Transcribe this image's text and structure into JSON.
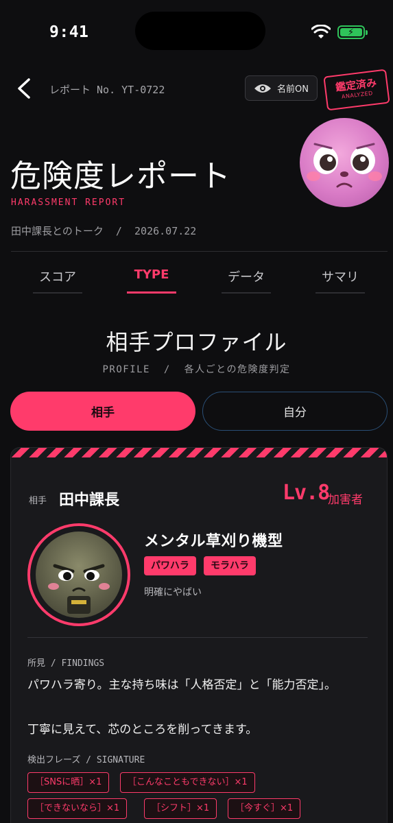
{
  "status_bar": {
    "time": "9:41"
  },
  "header": {
    "report_no": "レポート No. YT-0722",
    "name_toggle_label": "名前ON",
    "stamp_main": "鑑定済み",
    "stamp_sub": "ANALYZED"
  },
  "title": {
    "main": "危険度レポート",
    "subtitle": "HARASSMENT REPORT",
    "meta": "田中課長とのトーク  /  2026.07.22"
  },
  "tabs": [
    {
      "label": "スコア",
      "active": false
    },
    {
      "label": "TYPE",
      "active": true
    },
    {
      "label": "データ",
      "active": false
    },
    {
      "label": "サマリ",
      "active": false
    }
  ],
  "section": {
    "title": "相手プロファイル",
    "subtitle": "PROFILE  /  各人ごとの危険度判定"
  },
  "segments": {
    "left": "相手",
    "right": "自分"
  },
  "card": {
    "label": "相手",
    "name": "田中課長",
    "level": "Lv.8",
    "role": "加害者",
    "type_name": "メンタル草刈り機型",
    "tags": [
      "パワハラ",
      "モラハラ"
    ],
    "verdict": "明確にやばい",
    "findings_label": "所見 / FINDINGS",
    "findings_line1": "パワハラ寄り。主な持ち味は「人格否定」と「能力否定」。",
    "findings_line2": "丁寧に見えて、芯のところを削ってきます。",
    "signature_label": "検出フレーズ / SIGNATURE",
    "phrases": [
      "［SNSに晒］×1",
      "［こんなこともできない］×1",
      "［できないなら］×1",
      "［シフト］×1",
      "［今すぐ］×1"
    ]
  },
  "colors": {
    "accent": "#ff3b6b",
    "background": "#0e0e10",
    "card": "#19191c",
    "battery": "#2fc35a"
  }
}
